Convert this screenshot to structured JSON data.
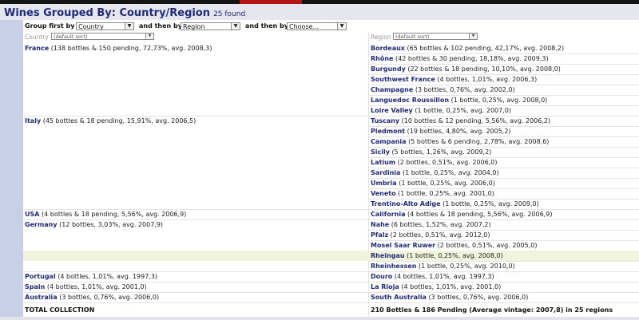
{
  "header": {
    "title": "Wines Grouped By: Country/Region",
    "found": "25 found"
  },
  "controls": {
    "group_first_label": "Group first by",
    "group_first_value": "Country",
    "then_by_label_1": "and then by",
    "then_by_value_1": "Region",
    "then_by_label_2": "and then by",
    "then_by_value_2": "Choose..."
  },
  "columns": {
    "country_header": "Country",
    "country_sort": "(default sort)",
    "region_header": "Region",
    "region_sort": "(default sort)"
  },
  "rows": [
    {
      "country": "France",
      "country_stats": " (138 bottles & 150 pending, 72,73%, avg. 2008,3)",
      "region": "Bordeaux",
      "region_stats": " (65 bottles & 102 pending, 42,17%, avg. 2008,2)"
    },
    {
      "country": "",
      "country_stats": "",
      "region": "Rhône",
      "region_stats": " (42 bottles & 30 pending, 18,18%, avg. 2009,3)"
    },
    {
      "country": "",
      "country_stats": "",
      "region": "Burgundy",
      "region_stats": " (22 bottles & 18 pending, 10,10%, avg. 2008,0)"
    },
    {
      "country": "",
      "country_stats": "",
      "region": "Southwest France",
      "region_stats": " (4 bottles, 1,01%, avg. 2006,3)"
    },
    {
      "country": "",
      "country_stats": "",
      "region": "Champagne",
      "region_stats": " (3 bottles, 0,76%, avg. 2002,0)"
    },
    {
      "country": "",
      "country_stats": "",
      "region": "Languedoc Roussillon",
      "region_stats": " (1 bottle, 0,25%, avg. 2008,0)"
    },
    {
      "country": "",
      "country_stats": "",
      "region": "Loire Valley",
      "region_stats": " (1 bottle, 0,25%, avg. 2007,0)"
    },
    {
      "country": "Italy",
      "country_stats": " (45 bottles & 18 pending, 15,91%, avg. 2006,5)",
      "region": "Tuscany",
      "region_stats": " (10 bottles & 12 pending, 5,56%, avg. 2006,2)"
    },
    {
      "country": "",
      "country_stats": "",
      "region": "Piedmont",
      "region_stats": " (19 bottles, 4,80%, avg. 2005,2)"
    },
    {
      "country": "",
      "country_stats": "",
      "region": "Campania",
      "region_stats": " (5 bottles & 6 pending, 2,78%, avg. 2008,6)"
    },
    {
      "country": "",
      "country_stats": "",
      "region": "Sicily",
      "region_stats": " (5 bottles, 1,26%, avg. 2009,2)"
    },
    {
      "country": "",
      "country_stats": "",
      "region": "Latium",
      "region_stats": " (2 bottles, 0,51%, avg. 2006,0)"
    },
    {
      "country": "",
      "country_stats": "",
      "region": "Sardinia",
      "region_stats": " (1 bottle, 0,25%, avg. 2004,0)"
    },
    {
      "country": "",
      "country_stats": "",
      "region": "Umbria",
      "region_stats": " (1 bottle, 0,25%, avg. 2006,0)"
    },
    {
      "country": "",
      "country_stats": "",
      "region": "Veneto",
      "region_stats": " (1 bottle, 0,25%, avg. 2001,0)"
    },
    {
      "country": "",
      "country_stats": "",
      "region": "Trentino-Alto Adige",
      "region_stats": " (1 bottle, 0,25%, avg. 2009,0)"
    },
    {
      "country": "USA",
      "country_stats": " (4 bottles & 18 pending, 5,56%, avg. 2006,9)",
      "region": "California",
      "region_stats": " (4 bottles & 18 pending, 5,56%, avg. 2006,9)"
    },
    {
      "country": "Germany",
      "country_stats": " (12 bottles, 3,03%, avg. 2007,9)",
      "region": "Nahe",
      "region_stats": " (6 bottles, 1,52%, avg. 2007,2)"
    },
    {
      "country": "",
      "country_stats": "",
      "region": "Pfalz",
      "region_stats": " (2 bottles, 0,51%, avg. 2012,0)"
    },
    {
      "country": "",
      "country_stats": "",
      "region": "Mosel Saar Ruwer",
      "region_stats": " (2 bottles, 0,51%, avg. 2005,0)"
    },
    {
      "country": "",
      "country_stats": "",
      "region": "Rheingau",
      "region_stats": " (1 bottle, 0,25%, avg. 2008,0)"
    },
    {
      "country": "",
      "country_stats": "",
      "region": "Rheinhessen",
      "region_stats": " (1 bottle, 0,25%, avg. 2010,0)"
    },
    {
      "country": "Portugal",
      "country_stats": " (4 bottles, 1,01%, avg. 1997,3)",
      "region": "Douro",
      "region_stats": " (4 bottles, 1,01%, avg. 1997,3)"
    },
    {
      "country": "Spain",
      "country_stats": " (4 bottles, 1,01%, avg. 2001,0)",
      "region": "La Rioja",
      "region_stats": " (4 bottles, 1,01%, avg. 2001,0)"
    },
    {
      "country": "Australia",
      "country_stats": " (3 bottles, 0,76%, avg. 2006,0)",
      "region": "South Australia",
      "region_stats": " (3 bottles, 0,76%, avg. 2006,0)"
    }
  ],
  "totals": {
    "label": "TOTAL COLLECTION",
    "summary": "210 Bottles & 186 Pending (Average vintage: 2007,8) in 25 regions"
  }
}
